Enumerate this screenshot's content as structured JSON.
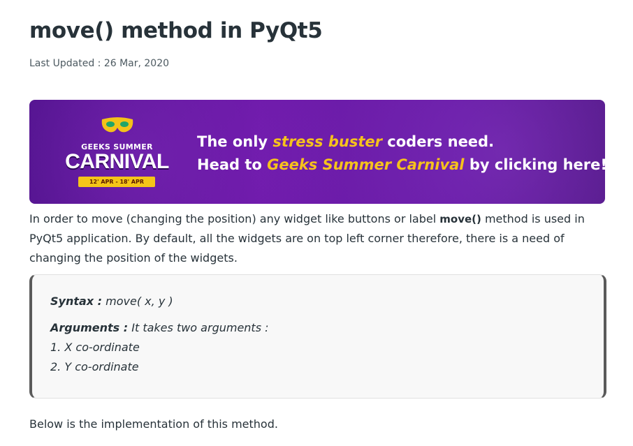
{
  "article": {
    "title": "move() method in PyQt5",
    "last_updated": "Last Updated : 26 Mar, 2020"
  },
  "banner": {
    "logo_top": "GEEKS SUMMER",
    "logo_main": "CARNIVAL",
    "logo_dates": "12' APR - 18' APR",
    "line1_pre": "The only ",
    "line1_highlight": "stress buster",
    "line1_post": " coders need.",
    "line2_pre": "Head to ",
    "line2_highlight": "Geeks Summer Carnival",
    "line2_post": " by clicking here!",
    "colors": {
      "background": "#5b119b",
      "highlight": "#f6c21c"
    }
  },
  "intro": {
    "part1": "In order to move (changing the position) any widget like buttons or label ",
    "code": "move()",
    "part2": " method is used in PyQt5 application. By default, all the widgets are on top left corner therefore, there is a need of changing the position of the widgets."
  },
  "syntax": {
    "syntax_label": "Syntax :",
    "syntax_value": " move( x, y )",
    "arguments_label": "Arguments :",
    "arguments_value": " It takes two arguments :",
    "arg1": "1. X co-ordinate",
    "arg2": "2. Y co-ordinate"
  },
  "below": "Below is the implementation of this method."
}
